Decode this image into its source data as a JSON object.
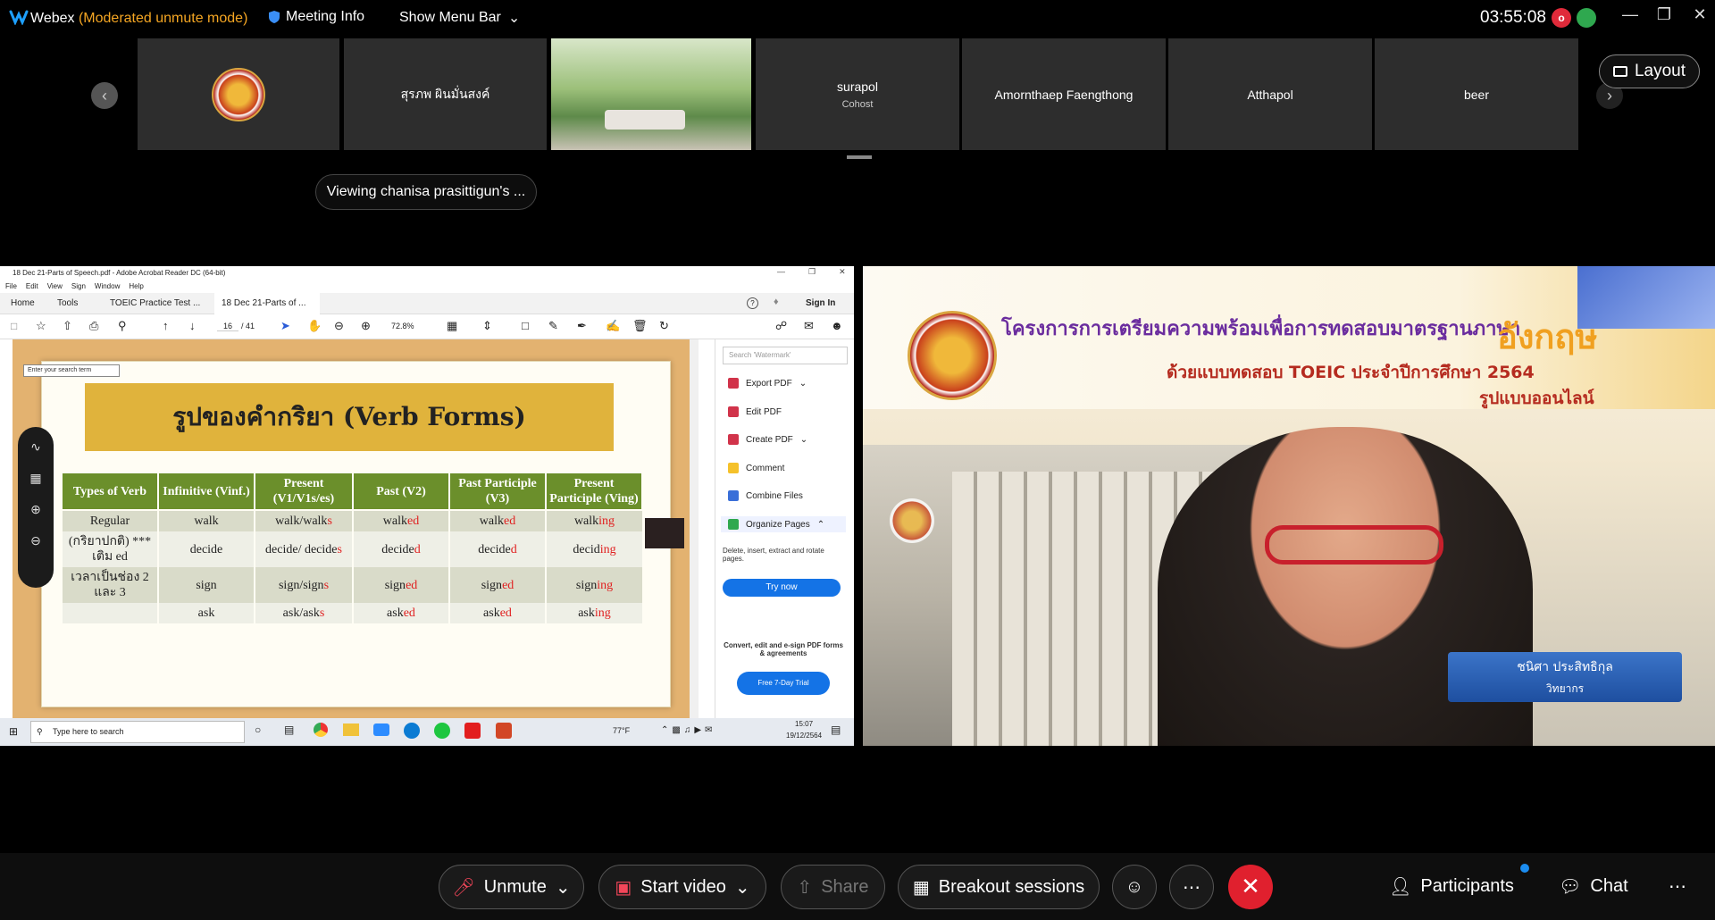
{
  "topbar": {
    "app": "Webex",
    "mode": "(Moderated unmute mode)",
    "meeting_info": "Meeting Info",
    "menu_bar": "Show Menu Bar",
    "timer": "03:55:08",
    "rec_letter": "o"
  },
  "strip": {
    "tiles": [
      {
        "name": ""
      },
      {
        "name": "สุรภพ ผินมั่นสงค์"
      },
      {
        "name": ""
      },
      {
        "name": "surapol",
        "sub": "Cohost"
      },
      {
        "name": "Amornthaep Faengthong"
      },
      {
        "name": "Atthapol"
      },
      {
        "name": "beer"
      }
    ],
    "layout_label": "Layout",
    "viewing": "Viewing chanisa prasittigun's ..."
  },
  "acrobat": {
    "title": "18 Dec 21-Parts of Speech.pdf - Adobe Acrobat Reader DC (64-bit)",
    "menu": [
      "File",
      "Edit",
      "View",
      "Sign",
      "Window",
      "Help"
    ],
    "tabs": [
      "Home",
      "Tools",
      "TOEIC Practice Test ...",
      "18 Dec 21-Parts of ..."
    ],
    "sign_in": "Sign In",
    "page_num": "16",
    "page_total": "/ 41",
    "zoom": "72.8%",
    "search_tip": "Enter your search term",
    "right_search_placeholder": "Search 'Watermark'",
    "tools": [
      "Export PDF",
      "Edit PDF",
      "Create PDF",
      "Comment",
      "Combine Files",
      "Organize Pages"
    ],
    "organize_desc": "Delete, insert, extract and rotate pages.",
    "try_now": "Try now",
    "promo": "Convert, edit and e-sign PDF forms & agreements",
    "trial": "Free 7-Day Trial"
  },
  "slide": {
    "title": "รูปของคำกริยา (Verb Forms)",
    "headers": [
      "Types of Verb",
      "Infinitive (Vinf.)",
      "Present (V1/V1s/es)",
      "Past (V2)",
      "Past Participle (V3)",
      "Present Participle (Ving)"
    ],
    "rows": [
      {
        "type": "Regular",
        "inf": "walk",
        "pres": "walk/walk",
        "pres_s": "s",
        "past": "walk",
        "past_s": "ed",
        "pp": "walk",
        "pp_s": "ed",
        "ing": "walk",
        "ing_s": "ing"
      },
      {
        "type": "(กริยาปกติ) *** เติม ed",
        "inf": "decide",
        "pres": "decide/ decide",
        "pres_s": "s",
        "past": "decide",
        "past_s": "d",
        "pp": "decide",
        "pp_s": "d",
        "ing": "decid",
        "ing_s": "ing"
      },
      {
        "type": "เวลาเป็นช่อง 2 และ 3",
        "inf": "sign",
        "pres": "sign/sign",
        "pres_s": "s",
        "past": "sign",
        "past_s": "ed",
        "pp": "sign",
        "pp_s": "ed",
        "ing": "sign",
        "ing_s": "ing"
      },
      {
        "type": "",
        "inf": "ask",
        "pres": "ask/ask",
        "pres_s": "s",
        "past": "ask",
        "past_s": "ed",
        "pp": "ask",
        "pp_s": "ed",
        "ing": "ask",
        "ing_s": "ing"
      }
    ]
  },
  "taskbar": {
    "search": "Type here to search",
    "weather": "77°F",
    "time": "15:07",
    "date": "19/12/2564"
  },
  "video": {
    "title1": "โครงการการเตรียมความพร้อมเพื่อการทดสอบมาตรฐานภาษา",
    "title_en": "อังกฤษ",
    "title2": "ด้วยแบบทดสอบ TOEIC ประจำปีการศึกษา 2564",
    "title3": "รูปแบบออนไลน์",
    "name_card": "ชนิศา ประสิทธิกุล",
    "name_role": "วิทยากร"
  },
  "controls": {
    "unmute": "Unmute",
    "start_video": "Start video",
    "share": "Share",
    "breakout": "Breakout sessions",
    "participants": "Participants",
    "chat": "Chat"
  },
  "colors": {
    "accent_mode": "#f5a623",
    "leave": "#e0202e",
    "slide_header": "#6b8f2b",
    "slide_title_bg": "#e0b33c",
    "try_now": "#1473e6"
  }
}
